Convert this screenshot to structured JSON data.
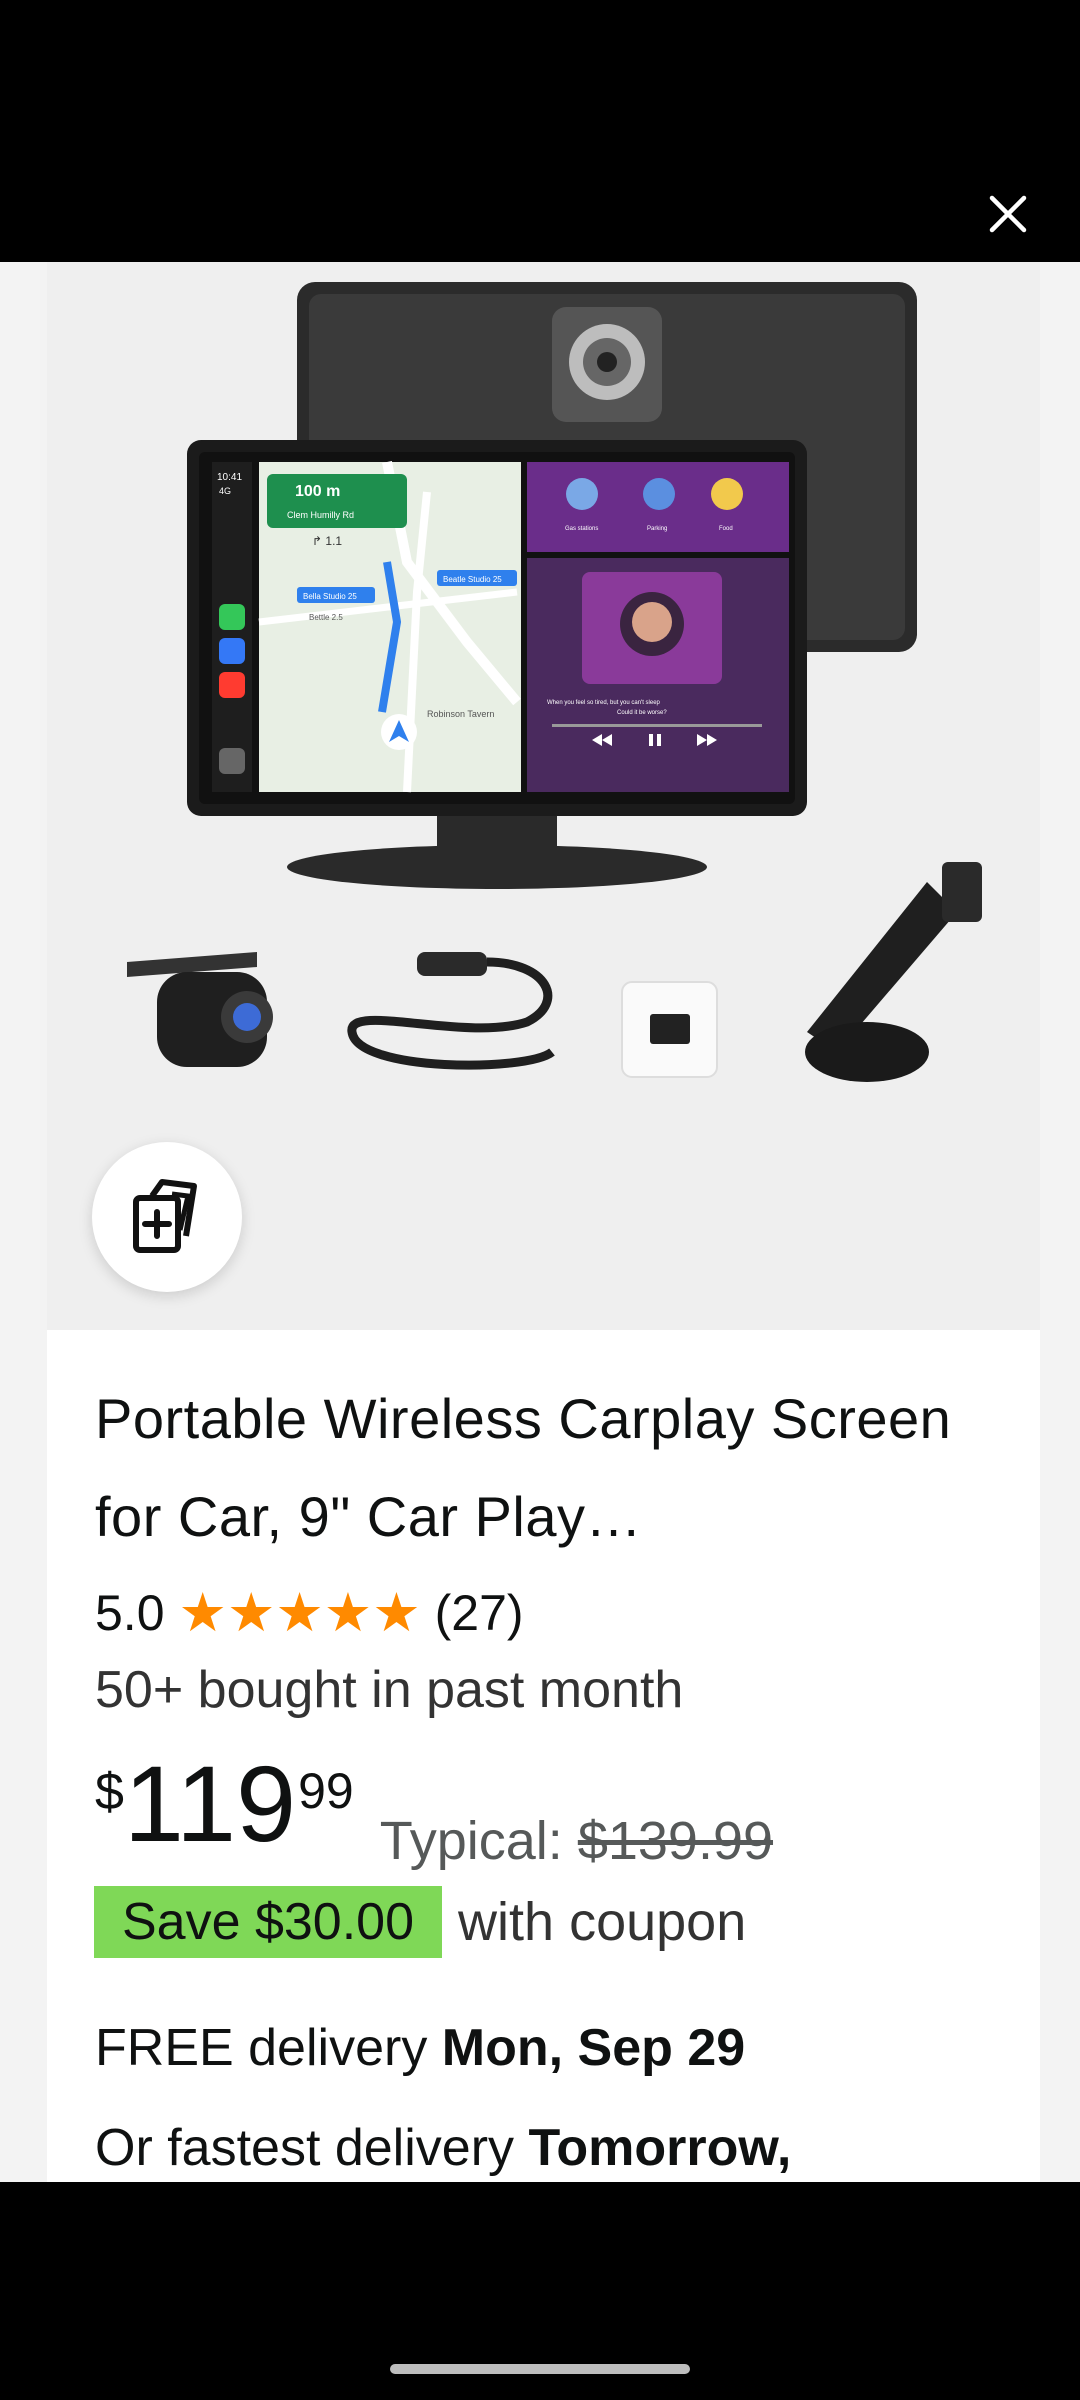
{
  "header": {
    "close_icon": "close-icon"
  },
  "product": {
    "title": "Portable Wireless Carplay Screen for Car, 9\" Car Play…",
    "rating": "5.0",
    "stars": 5,
    "review_count": "(27)",
    "bought": "50+ bought in past month",
    "price": {
      "currency": "$",
      "whole": "119",
      "fraction": "99"
    },
    "typical_label": "Typical: ",
    "typical_price": "$139.99",
    "coupon_badge": "Save $30.00",
    "coupon_text": "with coupon",
    "delivery1_text": "FREE delivery ",
    "delivery1_date": "Mon, Sep 29",
    "delivery2_text": "Or fastest delivery ",
    "delivery2_date": "Tomorrow,"
  },
  "screen_ui": {
    "time": "10:41",
    "signal": "4G",
    "nav_distance": "100 m",
    "nav_street": "Clem Humilly Rd",
    "nav_turn": "↱ 1.1",
    "map_label_1": "Bella Studio 25",
    "map_label_2": "Beatle Studio 25",
    "map_label_3": "Bettle 2.5",
    "map_place": "Robinson Tavern",
    "shortcut_1": "Gas stations",
    "shortcut_2": "Parking",
    "shortcut_3": "Food",
    "song_line1": "When you feel so tired, but you can't sleep",
    "song_line2": "Could it be worse?"
  },
  "colors": {
    "star": "#ff8a00",
    "coupon_bg": "#7fd857"
  }
}
